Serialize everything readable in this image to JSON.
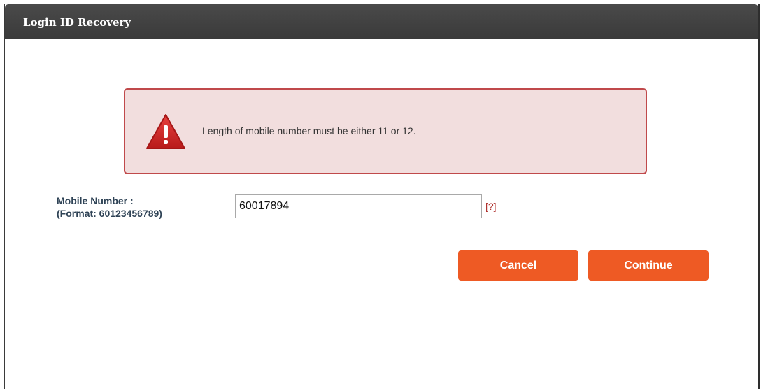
{
  "dialog": {
    "title": "Login ID Recovery"
  },
  "alert": {
    "icon": "warning-icon",
    "message": "Length of mobile number must be either 11 or 12.",
    "background_color": "#f2dede",
    "border_color": "#c0494b"
  },
  "form": {
    "mobile_label": "Mobile Number :",
    "mobile_format": "(Format: 60123456789)",
    "mobile_value": "60017894",
    "help_link": "[?]"
  },
  "buttons": {
    "cancel_label": "Cancel",
    "continue_label": "Continue",
    "color": "#ee5a24"
  }
}
